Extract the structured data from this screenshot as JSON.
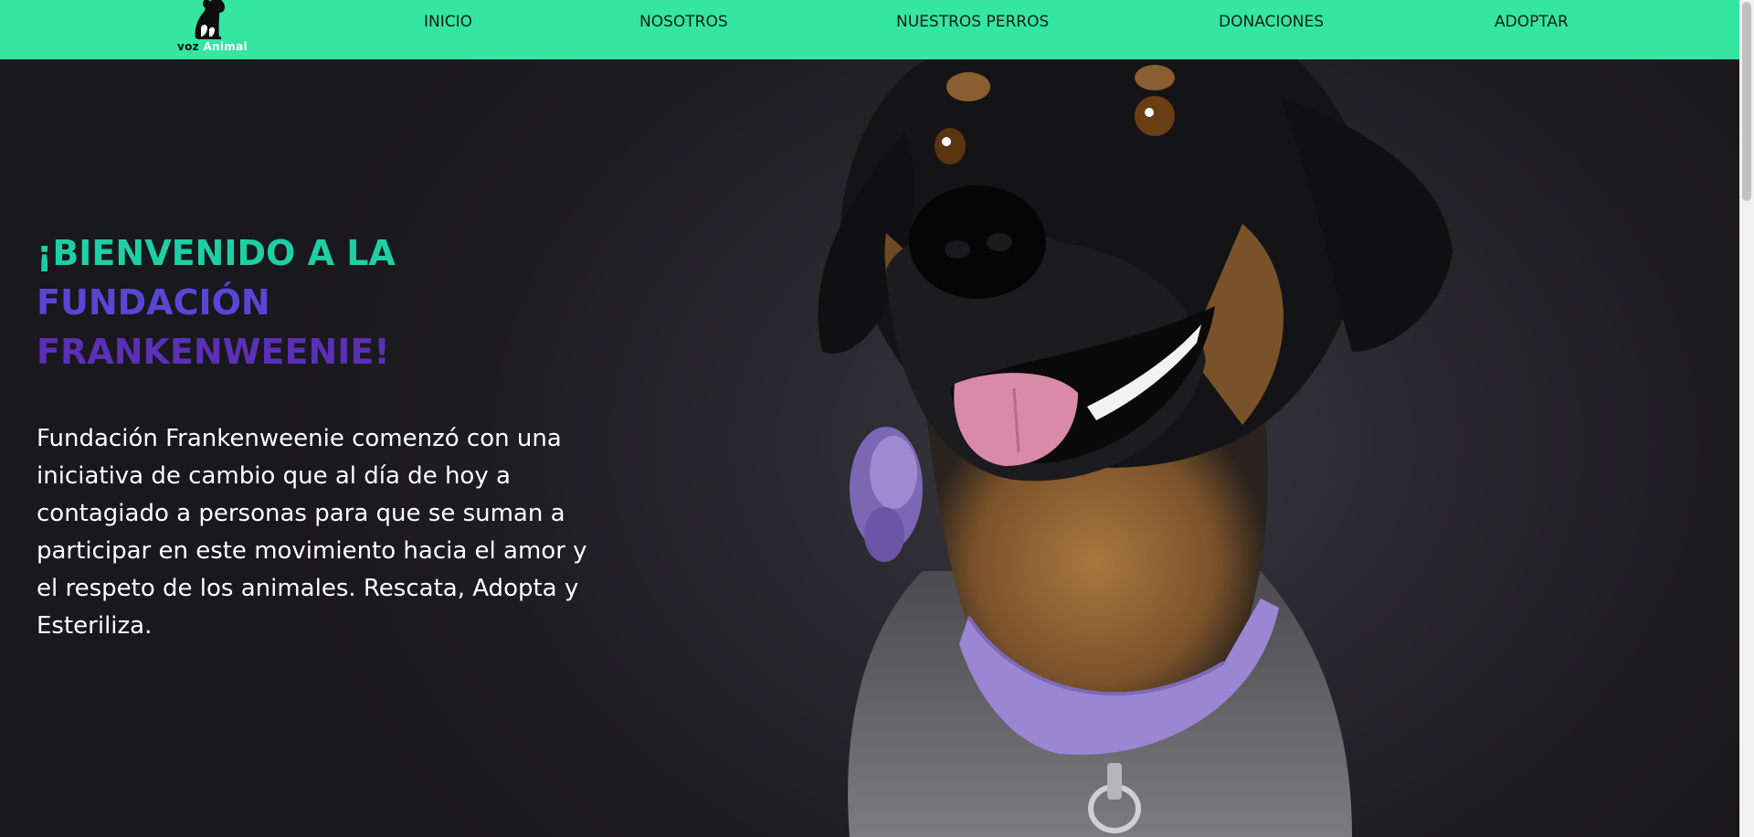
{
  "nav": {
    "logo": {
      "word1": "voz",
      "word2": "Animal"
    },
    "items": [
      {
        "label": "INICIO"
      },
      {
        "label": "NOSOTROS"
      },
      {
        "label": "NUESTROS PERROS"
      },
      {
        "label": "DONACIONES"
      },
      {
        "label": "ADOPTAR"
      }
    ]
  },
  "hero": {
    "title_part1": "¡BIENVENIDO A LA ",
    "title_part2": "FUNDACIÓN",
    "title_part3": "FRANKENWEENIE!",
    "text": "Fundación Frankenweenie comenzó con una iniciativa de cambio que al día de hoy a contagiado a personas para que se suman a participar en este movimiento hacia el amor y el respeto de los animales. Rescata, Adopta y Esteriliza."
  },
  "colors": {
    "nav_bg": "#34e69f",
    "title_teal": "#1ecfa5",
    "title_violet": "#5a46d6",
    "title_purple": "#5b2fb6",
    "hero_bg": "#1d1c21",
    "collar": "#9a86d2"
  },
  "icons": {
    "logo": "dog-silhouette-icon"
  }
}
